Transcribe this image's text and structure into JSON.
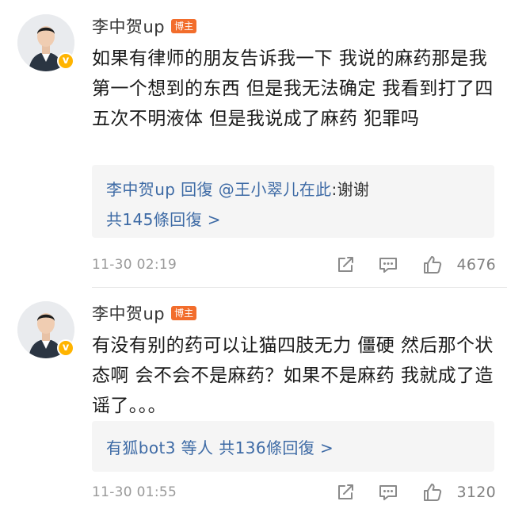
{
  "comments": [
    {
      "username": "李中贺up",
      "badge": "博主",
      "verified_mark": "v",
      "text": "如果有律师的朋友告诉我一下 我说的麻药那是我第一个想到的东西 但是我无法确定 我看到打了四五次不明液体 但是我说成了麻药 犯罪吗",
      "reply_author": "李中贺up",
      "reply_action": " 回復 ",
      "reply_mention": "@王小翠儿在此",
      "reply_text": ":谢谢",
      "reply_count_label": "共145條回復 >",
      "timestamp": "11-30 02:19",
      "likes": "4676"
    },
    {
      "username": "李中贺up",
      "badge": "博主",
      "verified_mark": "v",
      "text": "有没有别的药可以让猫四肢无力 僵硬 然后那个状态啊 会不会不是麻药？如果不是麻药 我就成了造谣了。。。",
      "reply_summary": "有狐bot3 等人 共136條回復 >",
      "timestamp": "11-30 01:55",
      "likes": "3120"
    }
  ],
  "icons": {
    "share": "share-icon",
    "comment": "comment-icon",
    "like": "thumbs-up-icon"
  },
  "colors": {
    "link": "#3d6aa5",
    "badge": "#f26d2c",
    "verified": "#ffb400",
    "meta": "#999999"
  }
}
